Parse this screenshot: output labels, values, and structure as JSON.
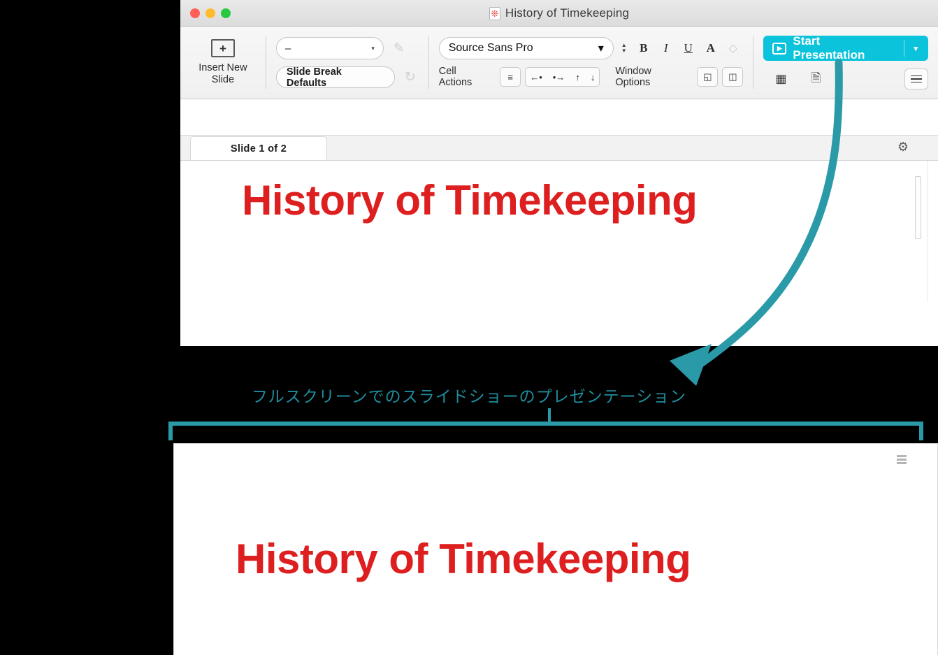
{
  "window": {
    "title": "History of Timekeeping",
    "doc_icon": "document-flower-icon",
    "traffic_lights": [
      "close",
      "minimize",
      "zoom"
    ]
  },
  "toolbar": {
    "insert_slide": {
      "icon": "plus-in-box-icon",
      "label_line1": "Insert New",
      "label_line2": "Slide"
    },
    "slide_break": {
      "dropdown_value": "–",
      "caret": "▾",
      "defaults_button": "Slide Break Defaults",
      "pen_icon": "style-pen-icon",
      "refresh_icon": "refresh-circle-icon"
    },
    "font": {
      "value": "Source Sans Pro",
      "caret": "▾",
      "size_stepper": "size-stepper",
      "bold": "B",
      "italic": "I",
      "underline": "U",
      "text_color": "A",
      "clear_format_icon": "eraser-icon"
    },
    "cell_actions": {
      "label": "Cell Actions",
      "align_icon": "≡",
      "arrows": [
        "←•",
        "•→",
        "↑",
        "↓"
      ]
    },
    "window_options": {
      "label": "Window Options",
      "fullscreen_icon": "fullscreen-expand-icon",
      "split_icon": "split-pane-icon"
    },
    "start_presentation": {
      "label": "Start Presentation",
      "play_icon": "▶",
      "caret": "▾",
      "color": "#0cc3dc"
    },
    "secondary_icons": [
      "grid-view-icon",
      "notes-view-icon"
    ],
    "menu_icon": "hamburger-menu-icon"
  },
  "tabbar": {
    "tab_label": "Slide 1 of  2",
    "gear_icon": "⚙"
  },
  "slide": {
    "title": "History of Timekeeping",
    "title_color": "#dd1f1f"
  },
  "annotation": {
    "caption": "フルスクリーンでのスライドショーのプレゼンテーション",
    "color": "#2a9aa8",
    "arrow": "curved-arrow-pointing-down-left",
    "bracket": "bottom-window-bracket"
  },
  "presentation_window": {
    "title": "History of Timekeeping",
    "menu_icon": "list-lines-icon"
  }
}
